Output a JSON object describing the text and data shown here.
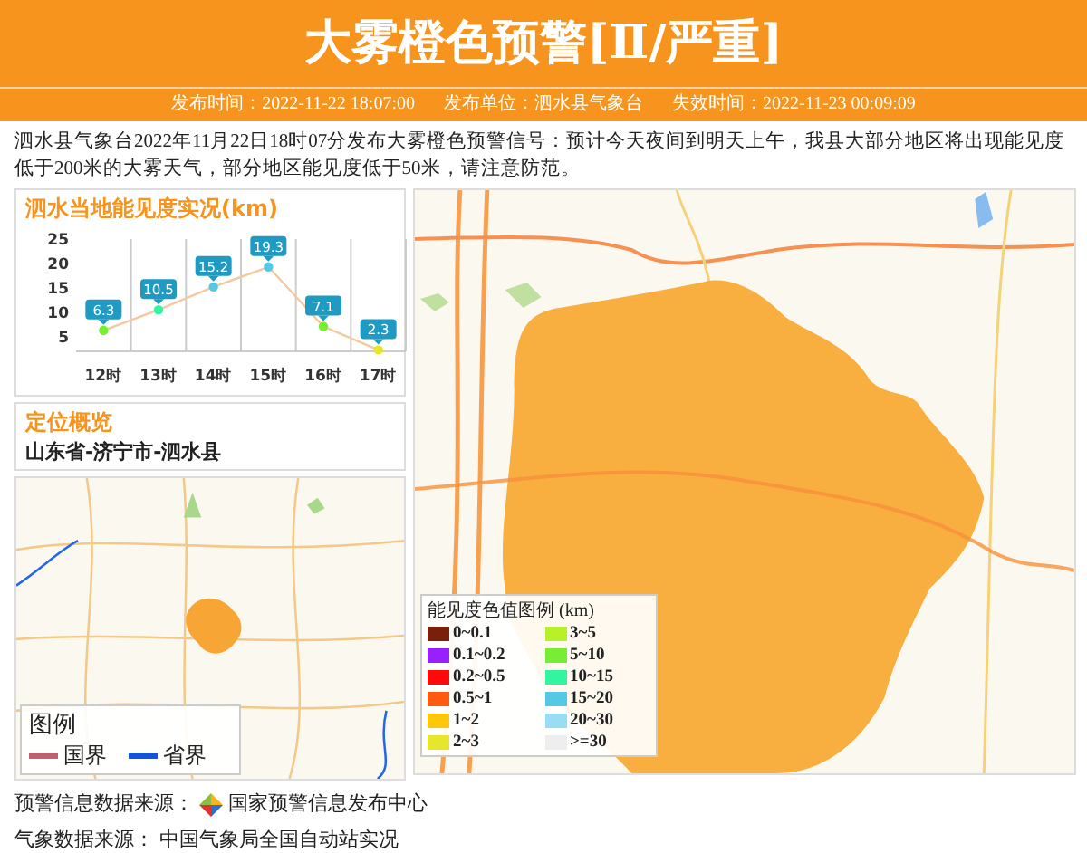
{
  "header": {
    "title": "大雾橙色预警[Ⅱ/严重]",
    "meta": [
      {
        "label": "发布时间：",
        "value": "2022-11-22 18:07:00"
      },
      {
        "label": "发布单位：",
        "value": "泗水县气象台"
      },
      {
        "label": "失效时间：",
        "value": "2022-11-23 00:09:09"
      }
    ]
  },
  "description": "泗水县气象台2022年11月22日18时07分发布大雾橙色预警信号：预计今天夜间到明天上午，我县大部分地区将出现能见度低于200米的大雾天气，部分地区能见度低于50米，请注意防范。",
  "visibility_panel": {
    "title": "泗水当地能见度实况(km)",
    "chart_data": {
      "type": "line",
      "categories": [
        "12时",
        "13时",
        "14时",
        "15时",
        "16时",
        "17时"
      ],
      "series": [
        {
          "color": "#f2c9a0",
          "marker": "circle",
          "values": [
            6.3,
            10.5,
            15.2,
            19.3,
            7.1,
            2.3
          ]
        }
      ],
      "ylim": [
        2,
        25
      ],
      "yticks": [
        5,
        10,
        15,
        20,
        25
      ],
      "data_labels": true
    }
  },
  "location_panel": {
    "title": "定位概览",
    "place": "山东省-济宁市-泗水县",
    "legend": {
      "title": "图例",
      "items": [
        {
          "label": "国界",
          "color": "#c06070"
        },
        {
          "label": "省界",
          "color": "#1155dd"
        }
      ]
    }
  },
  "visibility_legend": {
    "title": "能见度色值图例 (km)",
    "items": [
      {
        "label": "0~0.1",
        "color": "#7a1f0a"
      },
      {
        "label": "0.1~0.2",
        "color": "#9a1fff"
      },
      {
        "label": "0.2~0.5",
        "color": "#ff0a0a"
      },
      {
        "label": "0.5~1",
        "color": "#ff5a10"
      },
      {
        "label": "1~2",
        "color": "#ffc60a"
      },
      {
        "label": "2~3",
        "color": "#e6e62a"
      },
      {
        "label": "3~5",
        "color": "#b8f02a"
      },
      {
        "label": "5~10",
        "color": "#77ee33"
      },
      {
        "label": "10~15",
        "color": "#33f5a0"
      },
      {
        "label": "15~20",
        "color": "#55c8e6"
      },
      {
        "label": "20~30",
        "color": "#99ddf5"
      },
      {
        "label": ">=30",
        "color": "#eeeeee"
      }
    ]
  },
  "sources": [
    {
      "label": "预警信息数据来源：",
      "value": "国家预警信息发布中心",
      "logo": true
    },
    {
      "label": "气象数据来源：",
      "value": "中国气象局全国自动站实况",
      "logo": false
    }
  ]
}
